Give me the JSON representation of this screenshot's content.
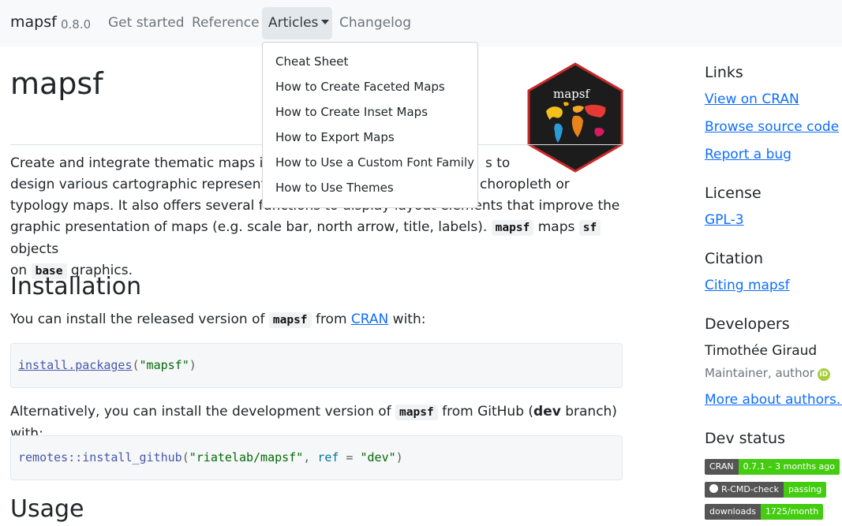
{
  "navbar": {
    "brand": "mapsf",
    "version": "0.8.0",
    "links": [
      "Get started",
      "Reference",
      "Articles",
      "Changelog"
    ]
  },
  "dropdown": {
    "items": [
      "Cheat Sheet",
      "How to Create Faceted Maps",
      "How to Create Inset Maps",
      "How to Export Maps",
      "How to Use a Custom Font Family",
      "How to Use Themes"
    ]
  },
  "logo": {
    "text": "mapsf",
    "bg_color": "#1c1c1c",
    "border_color": "#c62828"
  },
  "main": {
    "title": "mapsf",
    "intro": {
      "line1_left": "Create and integrate thematic maps in yo",
      "line1_right": "s to",
      "line2_left": "design various cartographic representati",
      "line2_right": "choropleth or",
      "line3": "typology maps. It also offers several functions to display layout elements that improve the",
      "line4_text": "graphic presentation of maps (e.g. scale bar, north arrow, title, labels).",
      "code_mapsf": "mapsf",
      "word_maps": "maps",
      "code_sf": "sf",
      "word_objects": "objects",
      "word_on": "on",
      "code_base": "base",
      "word_graphics": "graphics."
    },
    "installation": {
      "heading": "Installation",
      "p1_before": "You can install the released version of",
      "p1_code": "mapsf",
      "p1_from": "from",
      "p1_link": "CRAN",
      "p1_after": "with:",
      "code1_fn": "install.packages",
      "code1_open": "(",
      "code1_arg": "\"mapsf\"",
      "code1_close": ")",
      "p2_before": "Alternatively, you can install the development version of",
      "p2_code": "mapsf",
      "p2_mid": "from GitHub (",
      "p2_bold": "dev",
      "p2_after": "branch) with:",
      "code2_ns": "remotes::",
      "code2_fn": "install_github",
      "code2_open": "(",
      "code2_arg1": "\"riatelab/mapsf\"",
      "code2_comma": ", ",
      "code2_param": "ref",
      "code2_eq": " = ",
      "code2_arg2": "\"dev\"",
      "code2_close": ")"
    },
    "usage_heading": "Usage"
  },
  "sidebar": {
    "links_heading": "Links",
    "links": [
      "View on CRAN",
      "Browse source code",
      "Report a bug"
    ],
    "license_heading": "License",
    "license": "GPL-3",
    "citation_heading": "Citation",
    "citation": "Citing mapsf",
    "developers_heading": "Developers",
    "developer_name": "Timothée Giraud",
    "developer_role": "Maintainer, author",
    "orcid_icon": "orcid-icon",
    "more_authors": "More about authors...",
    "dev_status_heading": "Dev status",
    "badges": [
      {
        "label": "CRAN",
        "value": "0.7.1 – 3 months ago",
        "color": "#4c1"
      },
      {
        "label": "R-CMD-check",
        "value": "passing",
        "color": "#4c1"
      },
      {
        "label": "downloads",
        "value": "1725/month",
        "color": "#4c1"
      }
    ]
  }
}
